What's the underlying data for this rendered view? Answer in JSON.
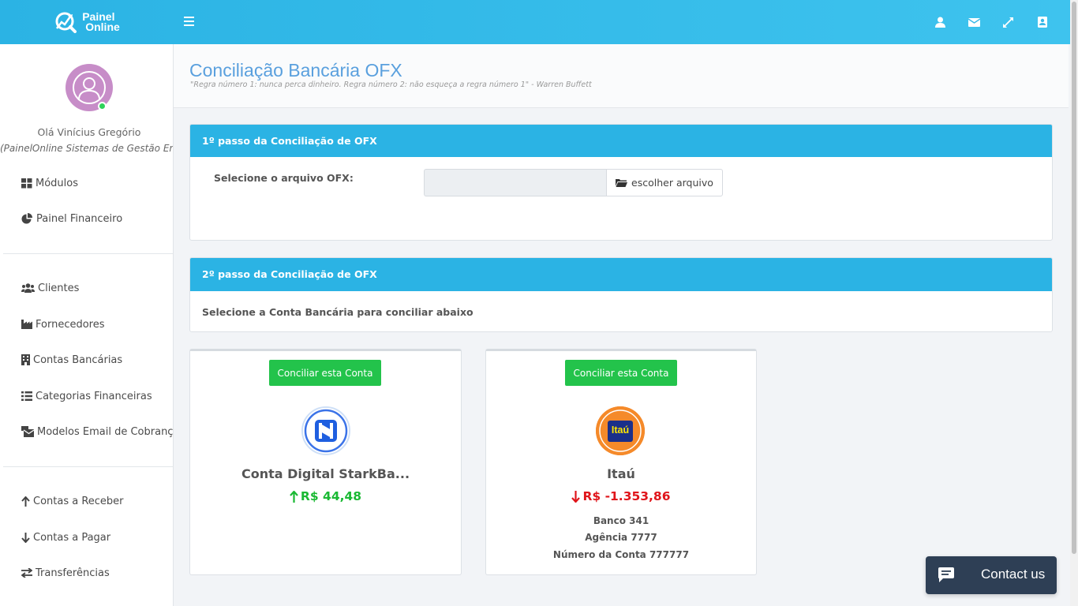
{
  "brand": {
    "line1": "Painel",
    "line2": "Online"
  },
  "header": {
    "icons": [
      "user-icon",
      "envelope-icon",
      "expand-icon",
      "contact-book-icon"
    ]
  },
  "sidebar": {
    "greeting": "Olá Vinícius Gregório",
    "company": "(PainelOnline Sistemas de Gestão Empresarial)",
    "groups": [
      [
        {
          "label": "Módulos",
          "icon": "grid-icon"
        },
        {
          "label": "Painel Financeiro",
          "icon": "pie-chart-icon"
        }
      ],
      [
        {
          "label": "Clientes",
          "icon": "users-icon"
        },
        {
          "label": "Fornecedores",
          "icon": "industry-icon"
        },
        {
          "label": "Contas Bancárias",
          "icon": "building-icon"
        },
        {
          "label": "Categorias Financeiras",
          "icon": "list-icon"
        },
        {
          "label": "Modelos Email de Cobrança",
          "icon": "mail-bulk-icon"
        }
      ],
      [
        {
          "label": "Contas a Receber",
          "icon": "arrow-up-icon"
        },
        {
          "label": "Contas a Pagar",
          "icon": "arrow-down-icon"
        },
        {
          "label": "Transferências",
          "icon": "exchange-icon"
        }
      ]
    ]
  },
  "page": {
    "title": "Conciliação Bancária OFX",
    "quote": "\"Regra número 1: nunca perca dinheiro. Regra número 2: não esqueça a regra número 1\" - Warren Buffett"
  },
  "step1": {
    "title": "1º passo da Conciliação de OFX",
    "label": "Selecione o arquivo OFX:",
    "file_value": "",
    "button": "escolher arquivo"
  },
  "step2": {
    "title": "2º passo da Conciliação de OFX",
    "label": "Selecione a Conta Bancária para conciliar abaixo"
  },
  "accounts": [
    {
      "button": "Conciliar esta Conta",
      "name": "Conta Digital StarkBa...",
      "balance": "R$ 44,48",
      "direction": "up",
      "color": "#1bb934",
      "logo": "starkbank-logo"
    },
    {
      "button": "Conciliar esta Conta",
      "name": "Itaú",
      "balance": "R$ -1.353,86",
      "direction": "down",
      "color": "#e0151b",
      "logo": "itau-logo",
      "logo_text": "Itaú",
      "bank": "Banco 341",
      "agency": "Agência 7777",
      "account_number": "Número da Conta 777777"
    }
  ],
  "contact": {
    "label": "Contact us"
  },
  "colors": {
    "primary": "#2bb3e4",
    "success": "#23c34b",
    "title": "#5aa0de",
    "chat": "#2e3f55"
  }
}
